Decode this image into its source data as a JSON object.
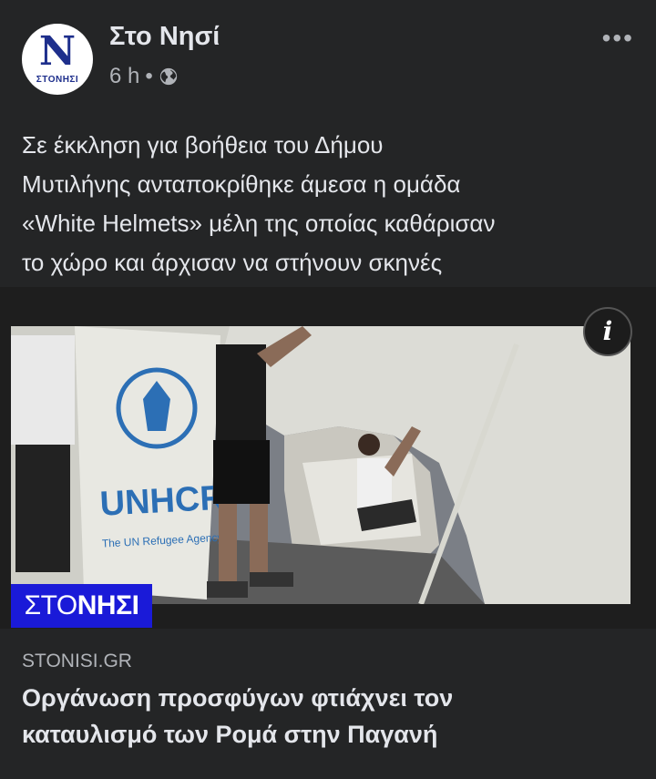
{
  "post": {
    "page_name": "Στο Νησί",
    "time": "6 h",
    "separator": "•",
    "privacy_icon": "globe-icon",
    "more_icon": "more-horizontal-icon",
    "more_label": "•••",
    "avatar": {
      "letter": "N",
      "sub_text": "ΣΤΟΝΗΣΙ"
    },
    "text_lines": [
      "Σε έκκληση για βοήθεια του Δήμου",
      "Μυτιλήνης ανταποκρίθηκε άμεσα η ομάδα",
      "«White Helmets» μέλη της οποίας καθάρισαν",
      "το χώρο και άρχισαν να στήνουν σκηνές"
    ]
  },
  "link_card": {
    "info_label": "i",
    "watermark": {
      "part1": "ΣΤΟ",
      "part2": "ΝΗΣΙ"
    },
    "photo_text": {
      "agency": "UNHCR",
      "agency_sub": "The UN Refugee Agency"
    },
    "domain": "STONISI.GR",
    "headline_lines": [
      "Οργάνωση προσφύγων φτιάχνει τον",
      "καταυλισμό των Ρομά στην Παγανή"
    ]
  },
  "colors": {
    "background": "#242526",
    "text_primary": "#e4e6eb",
    "text_secondary": "#b0b3b8",
    "watermark_blue": "#1a1ad8",
    "brand_navy": "#1e2f8c"
  }
}
